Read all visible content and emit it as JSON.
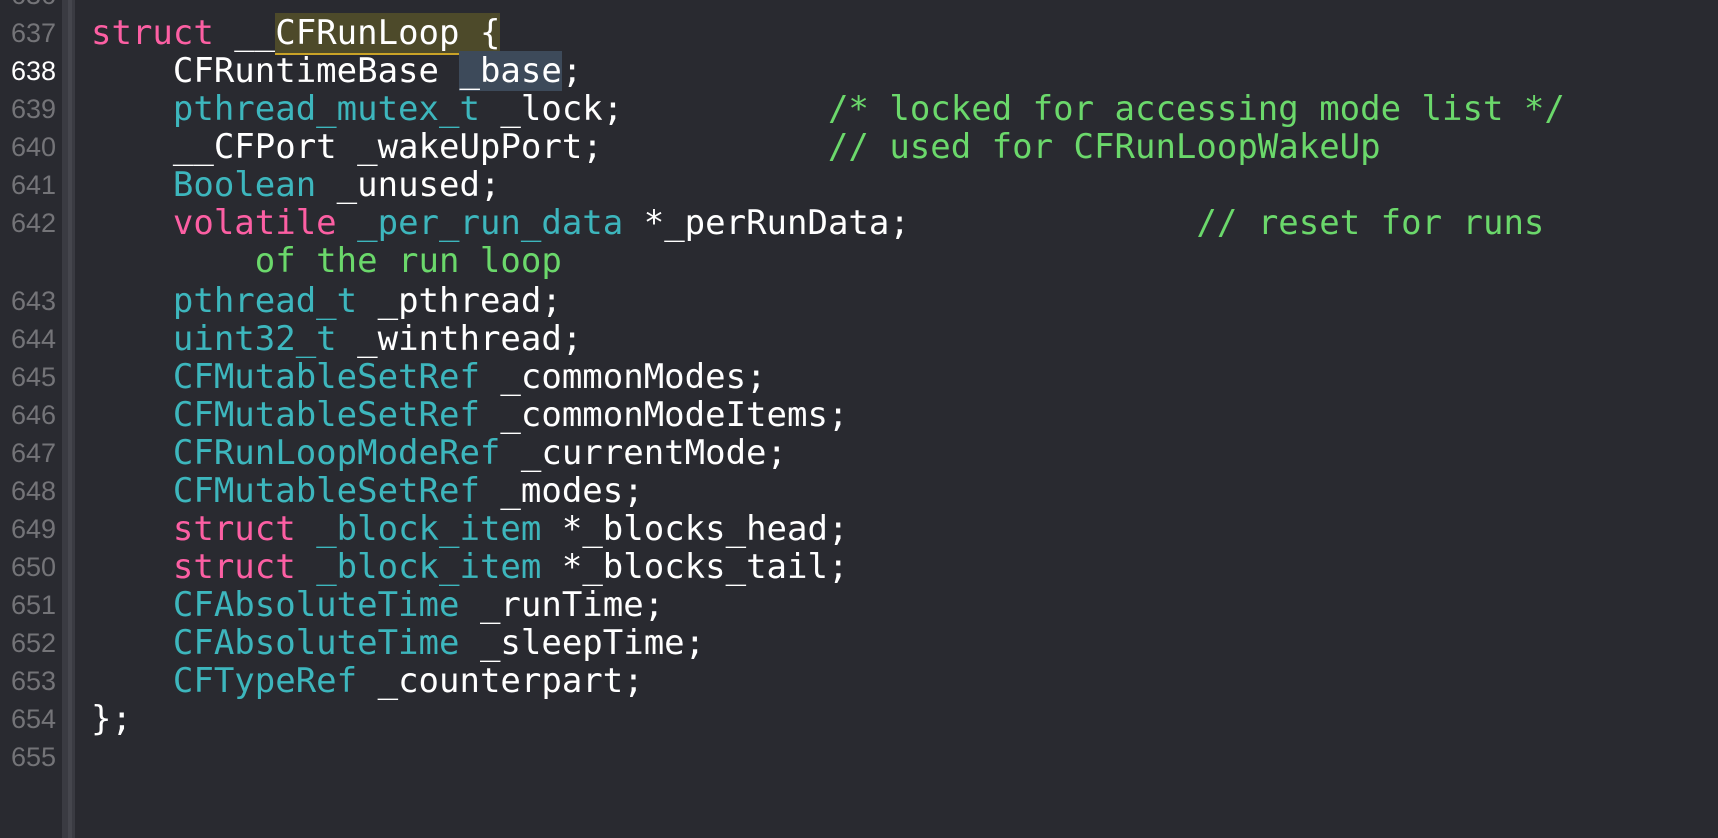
{
  "line_numbers": {
    "top_partial": "636",
    "n637": "637",
    "n638": "638",
    "n639": "639",
    "n640": "640",
    "n641": "641",
    "n642": "642",
    "n643": "643",
    "n644": "644",
    "n645": "645",
    "n646": "646",
    "n647": "647",
    "n648": "648",
    "n649": "649",
    "n650": "650",
    "n651": "651",
    "n652": "652",
    "n653": "653",
    "n654": "654",
    "n655": "655"
  },
  "code": {
    "l637": {
      "kw": "struct",
      "sp": " __",
      "name": "CFRunLoop {"
    },
    "l638": {
      "indent": "    ",
      "type": "CFRuntimeBase",
      "sp": " ",
      "var": "_base",
      "end": ";"
    },
    "l639": {
      "indent": "    ",
      "type": "pthread_mutex_t",
      "rest": " _lock;          ",
      "comment": "/* locked for accessing mode list */"
    },
    "l640": {
      "indent": "    ",
      "rest": "__CFPort _wakeUpPort;           ",
      "comment": "// used for CFRunLoopWakeUp"
    },
    "l641": {
      "indent": "    ",
      "type": "Boolean",
      "rest": " _unused;"
    },
    "l642": {
      "indent": "    ",
      "kw": "volatile",
      "sp": " ",
      "type": "_per_run_data",
      "rest": " *_perRunData;              ",
      "comment": "// reset for runs"
    },
    "l642b": {
      "indent": "        ",
      "comment": "of the run loop"
    },
    "l643": {
      "indent": "    ",
      "type": "pthread_t",
      "rest": " _pthread;"
    },
    "l644": {
      "indent": "    ",
      "type": "uint32_t",
      "rest": " _winthread;"
    },
    "l645": {
      "indent": "    ",
      "type": "CFMutableSetRef",
      "rest": " _commonModes;"
    },
    "l646": {
      "indent": "    ",
      "type": "CFMutableSetRef",
      "rest": " _commonModeItems;"
    },
    "l647": {
      "indent": "    ",
      "type": "CFRunLoopModeRef",
      "rest": " _currentMode;"
    },
    "l648": {
      "indent": "    ",
      "type": "CFMutableSetRef",
      "rest": " _modes;"
    },
    "l649": {
      "indent": "    ",
      "kw": "struct",
      "sp": " ",
      "type": "_block_item",
      "rest": " *_blocks_head;"
    },
    "l650": {
      "indent": "    ",
      "kw": "struct",
      "sp": " ",
      "type": "_block_item",
      "rest": " *_blocks_tail;"
    },
    "l651": {
      "indent": "    ",
      "type": "CFAbsoluteTime",
      "rest": " _runTime;"
    },
    "l652": {
      "indent": "    ",
      "type": "CFAbsoluteTime",
      "rest": " _sleepTime;"
    },
    "l653": {
      "indent": "    ",
      "type": "CFTypeRef",
      "rest": " _counterpart;"
    },
    "l654": {
      "rest": "};"
    }
  },
  "colors": {
    "background": "#292a30",
    "keyword": "#fc5fa3",
    "type": "#3db6bd",
    "comment": "#6bd86b",
    "plain": "#ffffff",
    "line_number": "#747478"
  }
}
